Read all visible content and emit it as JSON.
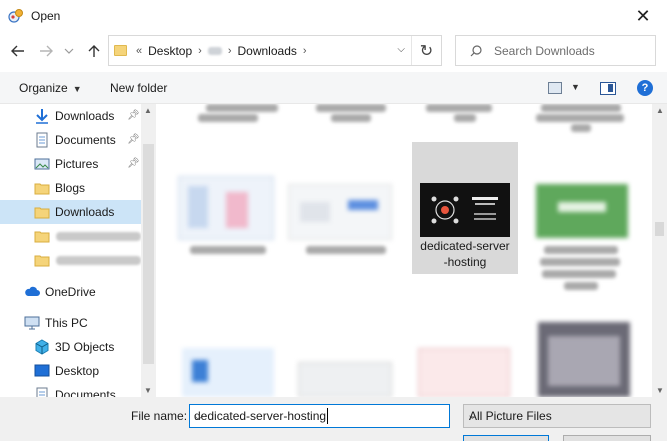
{
  "window": {
    "title": "Open"
  },
  "address": {
    "overflow_marker": "«",
    "crumbs": [
      "Desktop",
      "Downloads"
    ],
    "search_placeholder": "Search Downloads"
  },
  "toolbar": {
    "organize": "Organize",
    "new_folder": "New folder"
  },
  "nav": {
    "items": [
      {
        "label": "Downloads",
        "icon": "download-arrow-icon",
        "pinned": true
      },
      {
        "label": "Documents",
        "icon": "documents-icon",
        "pinned": true
      },
      {
        "label": "Pictures",
        "icon": "pictures-icon",
        "pinned": true
      },
      {
        "label": "Blogs",
        "icon": "folder-icon",
        "pinned": false
      },
      {
        "label": "Downloads",
        "icon": "folder-icon",
        "pinned": false,
        "selected": true
      },
      {
        "label": "OneDrive",
        "icon": "cloud-icon"
      },
      {
        "label": "This PC",
        "icon": "pc-icon"
      },
      {
        "label": "3D Objects",
        "icon": "3d-objects-icon"
      },
      {
        "label": "Desktop",
        "icon": "desktop-icon"
      },
      {
        "label": "Documents",
        "icon": "documents-icon"
      }
    ]
  },
  "files": {
    "selected": {
      "line1": "dedicated-server",
      "line2": "-hosting"
    }
  },
  "bottom": {
    "file_name_label": "File name:",
    "file_name_value": "dedicated-server-hosting",
    "filter_value": "All Picture Files"
  },
  "colors": {
    "accent": "#0078d7",
    "selection": "#cce4f7",
    "tile_selected": "#d9d9d9"
  }
}
